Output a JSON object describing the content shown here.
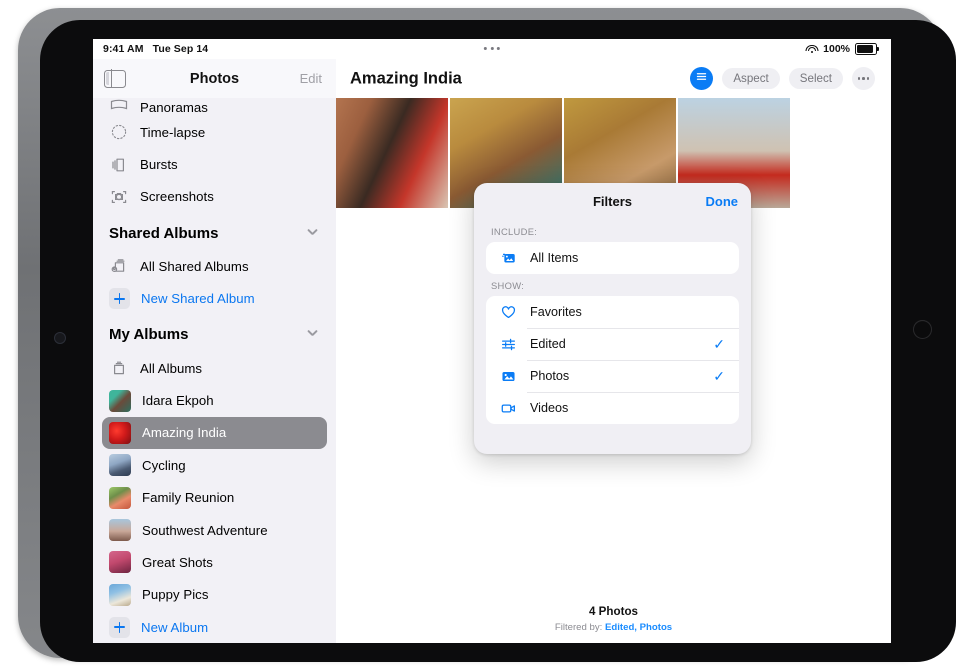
{
  "status_bar": {
    "time": "9:41 AM",
    "date": "Tue Sep 14",
    "battery_percent": "100%",
    "wifi_icon": "wifi-icon",
    "battery_icon": "battery-full-icon"
  },
  "sidebar": {
    "header": {
      "toggle_icon": "sidebar-toggle-icon",
      "title": "Photos",
      "edit_label": "Edit"
    },
    "top_items": [
      {
        "label": "Panoramas",
        "icon": "panorama-icon"
      },
      {
        "label": "Time-lapse",
        "icon": "timelapse-icon"
      },
      {
        "label": "Bursts",
        "icon": "bursts-icon"
      },
      {
        "label": "Screenshots",
        "icon": "screenshots-icon"
      }
    ],
    "shared_section": {
      "title": "Shared Albums",
      "chevron_icon": "chevron-down-icon",
      "items": [
        {
          "label": "All Shared Albums",
          "icon": "shared-album-icon",
          "kind": "icon"
        },
        {
          "label": "New Shared Album",
          "icon": "plus-icon",
          "kind": "plus"
        }
      ]
    },
    "my_albums_section": {
      "title": "My Albums",
      "chevron_icon": "chevron-down-icon",
      "items": [
        {
          "label": "All Albums",
          "kind": "icon",
          "icon": "albums-icon"
        },
        {
          "label": "Idara Ekpoh",
          "kind": "thumb",
          "color1": "#3fb59b",
          "color2": "#6b4a3a"
        },
        {
          "label": "Amazing India",
          "kind": "thumb",
          "color1": "#d11a1a",
          "color2": "#7a0f12",
          "selected": true
        },
        {
          "label": "Cycling",
          "kind": "thumb",
          "color1": "#8fa7c4",
          "color2": "#3a4a63"
        },
        {
          "label": "Family Reunion",
          "kind": "thumb",
          "color1": "#8fbf5a",
          "color2": "#e07a5f"
        },
        {
          "label": "Southwest Adventure",
          "kind": "thumb",
          "color1": "#9fc6de",
          "color2": "#8a6a5a"
        },
        {
          "label": "Great Shots",
          "kind": "thumb",
          "color1": "#c2496e",
          "color2": "#6d2440"
        },
        {
          "label": "Puppy Pics",
          "kind": "thumb",
          "color1": "#6ba7d8",
          "color2": "#e8e4d8"
        },
        {
          "label": "New Album",
          "kind": "plus",
          "icon": "plus-icon"
        }
      ]
    }
  },
  "main": {
    "title": "Amazing India",
    "toolbar": {
      "filter_icon": "filter-sliders-icon",
      "aspect_label": "Aspect",
      "select_label": "Select",
      "more_icon": "more-dots-icon"
    },
    "photos": [
      {
        "name": "woman-in-red-sari",
        "c1": "#a86a4a",
        "c2": "#c23a2a",
        "c3": "#d9c6b4"
      },
      {
        "name": "person-yellow-headwrap",
        "c1": "#c9a24b",
        "c2": "#8a5a33",
        "c3": "#1f7a7a"
      },
      {
        "name": "person-hands-over-face",
        "c1": "#b8913f",
        "c2": "#8a5e2d",
        "c3": "#c79a6a"
      },
      {
        "name": "dancer-red-scarf",
        "c1": "#b9cfe0",
        "c2": "#c9b9a8",
        "c3": "#c42a1e"
      }
    ],
    "footer": {
      "count": "4 Photos",
      "filtered_prefix": "Filtered by: ",
      "filtered_value": "Edited, Photos"
    }
  },
  "filters_popup": {
    "title": "Filters",
    "done_label": "Done",
    "include_label": "INCLUDE:",
    "include_items": [
      {
        "label": "All Items",
        "icon": "all-items-icon",
        "checked": false
      }
    ],
    "show_label": "SHOW:",
    "show_items": [
      {
        "label": "Favorites",
        "icon": "heart-icon",
        "checked": false
      },
      {
        "label": "Edited",
        "icon": "sliders-icon",
        "checked": true
      },
      {
        "label": "Photos",
        "icon": "photo-icon",
        "checked": true
      },
      {
        "label": "Videos",
        "icon": "video-icon",
        "checked": false
      }
    ],
    "check_glyph": "✓"
  },
  "colors": {
    "accent_blue": "#0a7cf5",
    "sidebar_bg": "#f2f1f6",
    "popup_bg": "#f0eff4",
    "selected_row": "#8b8b90"
  }
}
